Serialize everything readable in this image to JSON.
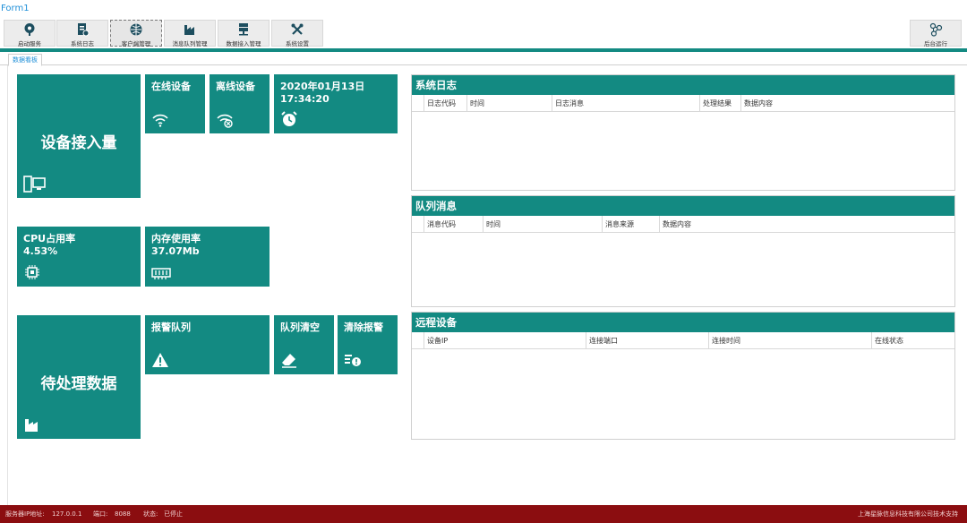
{
  "window": {
    "title": "Form1"
  },
  "toolbar": {
    "buttons": [
      {
        "label": "启动服务",
        "icon": "pin-icon"
      },
      {
        "label": "系统日志",
        "icon": "log-icon"
      },
      {
        "label": "客户端管理",
        "icon": "globe-icon"
      },
      {
        "label": "消息队列管理",
        "icon": "factory-icon"
      },
      {
        "label": "数据接入管理",
        "icon": "server-icon"
      },
      {
        "label": "系统设置",
        "icon": "tools-icon"
      }
    ],
    "right_button": {
      "label": "后台运行",
      "icon": "share-icon"
    }
  },
  "tabs": [
    {
      "label": "数据看板"
    }
  ],
  "tiles": {
    "device_access": {
      "title": "设备接入量",
      "icon": "devices-icon"
    },
    "online": {
      "title": "在线设备",
      "icon": "wifi-icon"
    },
    "offline": {
      "title": "离线设备",
      "icon": "wifi-off-icon"
    },
    "datetime": {
      "date": "2020年01月13日",
      "time": "17:34:20",
      "icon": "alarm-clock-icon"
    },
    "cpu": {
      "title": "CPU占用率",
      "value": "4.53%",
      "icon": "chip-icon"
    },
    "memory": {
      "title": "内存使用率",
      "value": "37.07Mb",
      "icon": "memory-icon"
    },
    "pending": {
      "title": "待处理数据",
      "icon": "factory-icon"
    },
    "alarm_queue": {
      "title": "报警队列",
      "icon": "warning-icon"
    },
    "queue_clear": {
      "title": "队列清空",
      "icon": "eraser-icon"
    },
    "clear_alarm": {
      "title": "清除报警",
      "icon": "alarm-list-icon"
    }
  },
  "panels": {
    "syslog": {
      "title": "系统日志",
      "columns": [
        "日志代码",
        "时间",
        "日志消息",
        "处理结果",
        "数据内容"
      ]
    },
    "queue": {
      "title": "队列消息",
      "columns": [
        "消息代码",
        "时间",
        "消息来源",
        "数据内容"
      ]
    },
    "remote": {
      "title": "远程设备",
      "columns": [
        "设备IP",
        "连接端口",
        "连接时间",
        "在线状态"
      ]
    }
  },
  "status": {
    "ip_label": "服务器IP地址:",
    "ip": "127.0.0.1",
    "port_label": "端口:",
    "port": "8088",
    "state_label": "状态:",
    "state": "已停止",
    "right": "上海星脉信息科技有限公司技术支持"
  },
  "colors": {
    "accent": "#138a82",
    "status_bar": "#8b0d10",
    "title_blue": "#1f8fd8"
  }
}
